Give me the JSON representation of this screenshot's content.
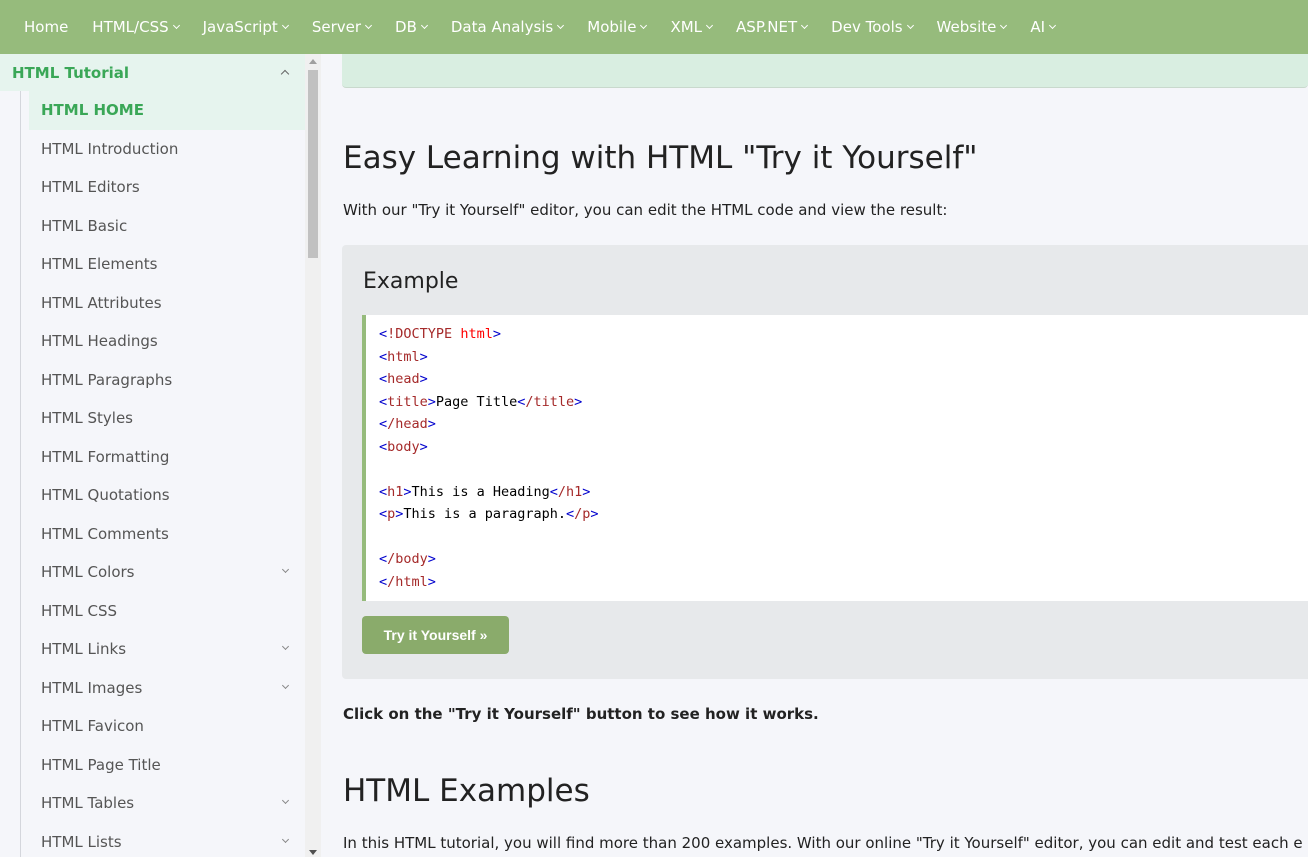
{
  "topnav": {
    "items": [
      {
        "label": "Home",
        "dropdown": false
      },
      {
        "label": "HTML/CSS",
        "dropdown": true
      },
      {
        "label": "JavaScript",
        "dropdown": true
      },
      {
        "label": "Server",
        "dropdown": true
      },
      {
        "label": "DB",
        "dropdown": true
      },
      {
        "label": "Data Analysis",
        "dropdown": true
      },
      {
        "label": "Mobile",
        "dropdown": true
      },
      {
        "label": "XML",
        "dropdown": true
      },
      {
        "label": "ASP.NET",
        "dropdown": true
      },
      {
        "label": "Dev Tools",
        "dropdown": true
      },
      {
        "label": "Website",
        "dropdown": true
      },
      {
        "label": "AI",
        "dropdown": true
      }
    ]
  },
  "sidebar": {
    "section_title": "HTML Tutorial",
    "items": [
      {
        "label": "HTML HOME",
        "active": true,
        "expandable": false
      },
      {
        "label": "HTML Introduction",
        "active": false,
        "expandable": false
      },
      {
        "label": "HTML Editors",
        "active": false,
        "expandable": false
      },
      {
        "label": "HTML Basic",
        "active": false,
        "expandable": false
      },
      {
        "label": "HTML Elements",
        "active": false,
        "expandable": false
      },
      {
        "label": "HTML Attributes",
        "active": false,
        "expandable": false
      },
      {
        "label": "HTML Headings",
        "active": false,
        "expandable": false
      },
      {
        "label": "HTML Paragraphs",
        "active": false,
        "expandable": false
      },
      {
        "label": "HTML Styles",
        "active": false,
        "expandable": false
      },
      {
        "label": "HTML Formatting",
        "active": false,
        "expandable": false
      },
      {
        "label": "HTML Quotations",
        "active": false,
        "expandable": false
      },
      {
        "label": "HTML Comments",
        "active": false,
        "expandable": false
      },
      {
        "label": "HTML Colors",
        "active": false,
        "expandable": true
      },
      {
        "label": "HTML CSS",
        "active": false,
        "expandable": false
      },
      {
        "label": "HTML Links",
        "active": false,
        "expandable": true
      },
      {
        "label": "HTML Images",
        "active": false,
        "expandable": true
      },
      {
        "label": "HTML Favicon",
        "active": false,
        "expandable": false
      },
      {
        "label": "HTML Page Title",
        "active": false,
        "expandable": false
      },
      {
        "label": "HTML Tables",
        "active": false,
        "expandable": true
      },
      {
        "label": "HTML Lists",
        "active": false,
        "expandable": true
      }
    ]
  },
  "main": {
    "heading": "Easy Learning with HTML \"Try it Yourself\"",
    "intro": "With our \"Try it Yourself\" editor, you can edit the HTML code and view the result:",
    "example": {
      "title": "Example",
      "code_lines": [
        "<!DOCTYPE html>",
        "<html>",
        "<head>",
        "<title>Page Title</title>",
        "</head>",
        "<body>",
        "",
        "<h1>This is a Heading</h1>",
        "<p>This is a paragraph.</p>",
        "",
        "</body>",
        "</html>"
      ],
      "button_label": "Try it Yourself »"
    },
    "note": "Click on the \"Try it Yourself\" button to see how it works.",
    "section2_heading": "HTML Examples",
    "section2_text": "In this HTML tutorial, you will find more than 200 examples. With our online \"Try it Yourself\" editor, you can edit and test each e"
  }
}
